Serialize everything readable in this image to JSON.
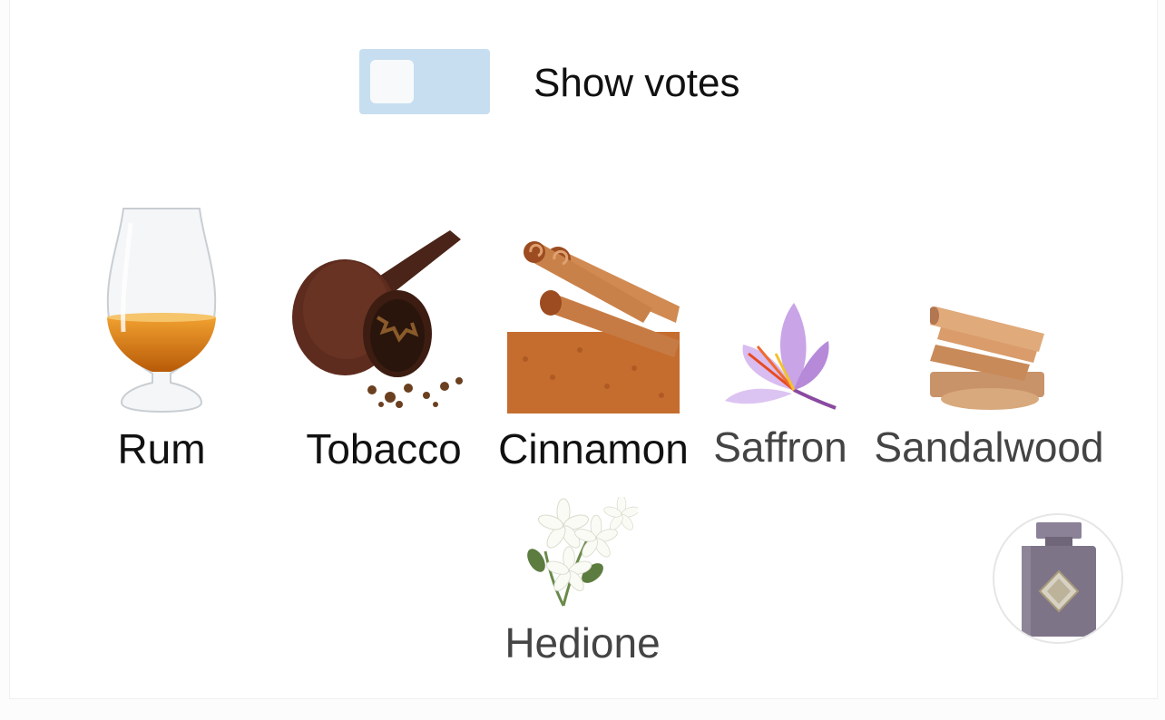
{
  "controls": {
    "show_votes_label": "Show votes",
    "show_votes_on": false
  },
  "notes": [
    {
      "label": "Rum",
      "icon": "rum-glass-icon",
      "emphasis": "strong"
    },
    {
      "label": "Tobacco",
      "icon": "tobacco-pipe-icon",
      "emphasis": "strong"
    },
    {
      "label": "Cinnamon",
      "icon": "cinnamon-sticks-icon",
      "emphasis": "strong"
    },
    {
      "label": "Saffron",
      "icon": "saffron-flower-icon",
      "emphasis": "weak"
    },
    {
      "label": "Sandalwood",
      "icon": "sandalwood-icon",
      "emphasis": "weak"
    },
    {
      "label": "Hedione",
      "icon": "jasmine-flower-icon",
      "emphasis": "weak"
    }
  ],
  "colors": {
    "toggle_bg": "#c6def0",
    "strong_text": "#111111",
    "weak_text": "#444444",
    "bottle": "#7e7488"
  }
}
